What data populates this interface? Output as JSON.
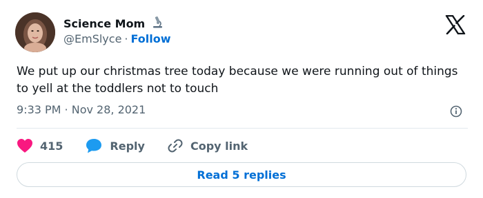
{
  "author": {
    "name": "Science Mom",
    "handle": "@EmSlyce",
    "separator": "·",
    "follow_label": "Follow",
    "badge_icon": "microscope-icon",
    "avatar_icon": "avatar"
  },
  "platform_icon": "x-logo-icon",
  "tweet": {
    "text": "We put up our christmas tree today because we were running out of things to yell at the toddlers not to touch",
    "timestamp": "9:33 PM · Nov 28, 2021",
    "info_icon": "info-icon"
  },
  "actions": {
    "likes_count": "415",
    "like_icon": "heart-icon",
    "reply_label": "Reply",
    "reply_icon": "speech-bubble-icon",
    "copy_label": "Copy link",
    "copy_icon": "link-icon"
  },
  "read_replies_label": "Read 5 replies",
  "colors": {
    "accent": "#006fd6",
    "heart": "#f91880",
    "reply_bubble": "#1d9bf0",
    "muted": "#536471",
    "text": "#0f1419"
  }
}
